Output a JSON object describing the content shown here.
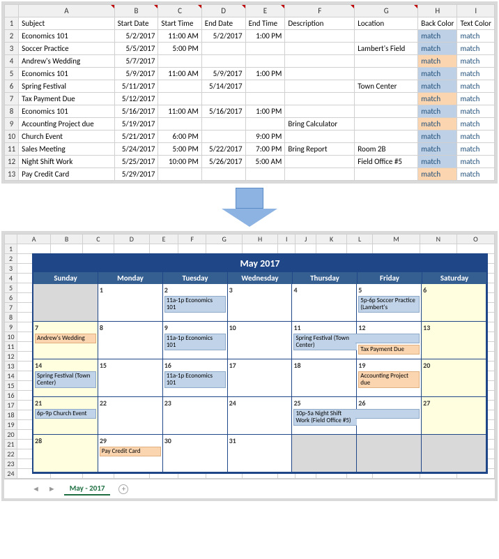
{
  "top": {
    "columns": [
      "A",
      "B",
      "C",
      "D",
      "E",
      "F",
      "G",
      "H",
      "I"
    ],
    "headers": [
      "Subject",
      "Start Date",
      "Start Time",
      "End Date",
      "End Time",
      "Description",
      "Location",
      "Back Color",
      "Text Color"
    ],
    "rows": [
      {
        "n": 2,
        "subject": "Economics 101",
        "sdate": "5/2/2017",
        "stime": "11:00 AM",
        "edate": "5/2/2017",
        "etime": "1:00 PM",
        "desc": "",
        "loc": "",
        "bc": "match",
        "tc": "match",
        "bcbg": "blue"
      },
      {
        "n": 3,
        "subject": "Soccer Practice",
        "sdate": "5/5/2017",
        "stime": "5:00 PM",
        "edate": "",
        "etime": "",
        "desc": "",
        "loc": "Lambert's Field",
        "bc": "match",
        "tc": "match",
        "bcbg": "blue"
      },
      {
        "n": 4,
        "subject": "Andrew's Wedding",
        "sdate": "5/7/2017",
        "stime": "",
        "edate": "",
        "etime": "",
        "desc": "",
        "loc": "",
        "bc": "match",
        "tc": "match",
        "bcbg": "orange"
      },
      {
        "n": 5,
        "subject": "Economics 101",
        "sdate": "5/9/2017",
        "stime": "11:00 AM",
        "edate": "5/9/2017",
        "etime": "1:00 PM",
        "desc": "",
        "loc": "",
        "bc": "match",
        "tc": "match",
        "bcbg": "blue"
      },
      {
        "n": 6,
        "subject": "Spring Festival",
        "sdate": "5/11/2017",
        "stime": "",
        "edate": "5/14/2017",
        "etime": "",
        "desc": "",
        "loc": "Town Center",
        "bc": "match",
        "tc": "match",
        "bcbg": "blue"
      },
      {
        "n": 7,
        "subject": "Tax Payment Due",
        "sdate": "5/12/2017",
        "stime": "",
        "edate": "",
        "etime": "",
        "desc": "",
        "loc": "",
        "bc": "match",
        "tc": "match",
        "bcbg": "orange"
      },
      {
        "n": 8,
        "subject": "Economics 101",
        "sdate": "5/16/2017",
        "stime": "11:00 AM",
        "edate": "5/16/2017",
        "etime": "1:00 PM",
        "desc": "",
        "loc": "",
        "bc": "match",
        "tc": "match",
        "bcbg": "blue"
      },
      {
        "n": 9,
        "subject": "Accounting Project due",
        "sdate": "5/19/2017",
        "stime": "",
        "edate": "",
        "etime": "",
        "desc": "Bring Calculator",
        "loc": "",
        "bc": "match",
        "tc": "match",
        "bcbg": "orange"
      },
      {
        "n": 10,
        "subject": "Church Event",
        "sdate": "5/21/2017",
        "stime": "6:00 PM",
        "edate": "",
        "etime": "9:00 PM",
        "desc": "",
        "loc": "",
        "bc": "match",
        "tc": "match",
        "bcbg": "blue"
      },
      {
        "n": 11,
        "subject": "Sales Meeting",
        "sdate": "5/24/2017",
        "stime": "5:00 PM",
        "edate": "5/22/2017",
        "etime": "7:00 PM",
        "desc": "Bring Report",
        "loc": "Room 2B",
        "bc": "match",
        "tc": "match",
        "bcbg": "blue"
      },
      {
        "n": 12,
        "subject": "Night Shift Work",
        "sdate": "5/25/2017",
        "stime": "10:00 PM",
        "edate": "5/26/2017",
        "etime": "5:00 AM",
        "desc": "",
        "loc": "Field Office #5",
        "bc": "match",
        "tc": "match",
        "bcbg": "blue"
      },
      {
        "n": 13,
        "subject": "Pay Credit Card",
        "sdate": "5/29/2017",
        "stime": "",
        "edate": "",
        "etime": "",
        "desc": "",
        "loc": "",
        "bc": "match",
        "tc": "match",
        "bcbg": "orange"
      }
    ]
  },
  "bottom": {
    "columns": [
      "A",
      "B",
      "C",
      "D",
      "E",
      "F",
      "G",
      "H",
      "I",
      "J",
      "K",
      "L",
      "M",
      "N",
      "O"
    ],
    "row_labels": [
      "1",
      "2",
      "3",
      "4",
      "5",
      "6",
      "7",
      "8",
      "9",
      "10",
      "11",
      "12",
      "13",
      "14",
      "15",
      "16",
      "17",
      "18",
      "19",
      "20",
      "21",
      "22",
      "23",
      "24"
    ],
    "title": "May 2017",
    "weekdays": [
      "Sunday",
      "Monday",
      "Tuesday",
      "Wednesday",
      "Thursday",
      "Friday",
      "Saturday"
    ],
    "weeks": [
      [
        {
          "d": "",
          "cls": "gray"
        },
        {
          "d": "1"
        },
        {
          "d": "2",
          "ev": [
            {
              "t": "11a-1p Economics 101",
              "c": "blue"
            }
          ]
        },
        {
          "d": "3"
        },
        {
          "d": "4"
        },
        {
          "d": "5",
          "ev": [
            {
              "t": "5p-6p Soccer Practice (Lambert's",
              "c": "blue"
            }
          ]
        },
        {
          "d": "6",
          "cls": "weekend"
        }
      ],
      [
        {
          "d": "7",
          "cls": "weekend",
          "ev": [
            {
              "t": "Andrew's Wedding",
              "c": "orange"
            }
          ]
        },
        {
          "d": "8"
        },
        {
          "d": "9",
          "ev": [
            {
              "t": "11a-1p Economics 101",
              "c": "blue"
            }
          ]
        },
        {
          "d": "10"
        },
        {
          "d": "11",
          "ev": [
            {
              "t": "Spring Festival (Town Center)",
              "c": "blue",
              "span": true
            }
          ]
        },
        {
          "d": "12",
          "ev": [
            {
              "t": "",
              "c": "blue",
              "spanend": true
            },
            {
              "t": "Tax Payment Due",
              "c": "orange"
            }
          ]
        },
        {
          "d": "13",
          "cls": "weekend"
        }
      ],
      [
        {
          "d": "14",
          "cls": "weekend",
          "ev": [
            {
              "t": "Spring Festival (Town Center)",
              "c": "blue"
            }
          ]
        },
        {
          "d": "15"
        },
        {
          "d": "16",
          "ev": [
            {
              "t": "11a-1p Economics 101",
              "c": "blue"
            }
          ]
        },
        {
          "d": "17"
        },
        {
          "d": "18"
        },
        {
          "d": "19",
          "ev": [
            {
              "t": "Accounting Project due",
              "c": "orange"
            }
          ]
        },
        {
          "d": "20",
          "cls": "weekend"
        }
      ],
      [
        {
          "d": "21",
          "cls": "weekend",
          "ev": [
            {
              "t": "6p-9p Church Event",
              "c": "blue"
            }
          ]
        },
        {
          "d": "22"
        },
        {
          "d": "23"
        },
        {
          "d": "24"
        },
        {
          "d": "25",
          "ev": [
            {
              "t": "10p-5a Night Shift Work (Field Office #5)",
              "c": "blue",
              "span": true
            }
          ]
        },
        {
          "d": "26",
          "ev": [
            {
              "t": "",
              "c": "blue",
              "spanend": true
            }
          ]
        },
        {
          "d": "27",
          "cls": "weekend"
        }
      ],
      [
        {
          "d": "28",
          "cls": "weekend"
        },
        {
          "d": "29",
          "ev": [
            {
              "t": "Pay Credit Card",
              "c": "orange"
            }
          ]
        },
        {
          "d": "30"
        },
        {
          "d": "31"
        },
        {
          "d": "",
          "cls": "gray"
        },
        {
          "d": "",
          "cls": "gray"
        },
        {
          "d": "",
          "cls": "gray"
        }
      ]
    ],
    "tab": "May - 2017"
  }
}
